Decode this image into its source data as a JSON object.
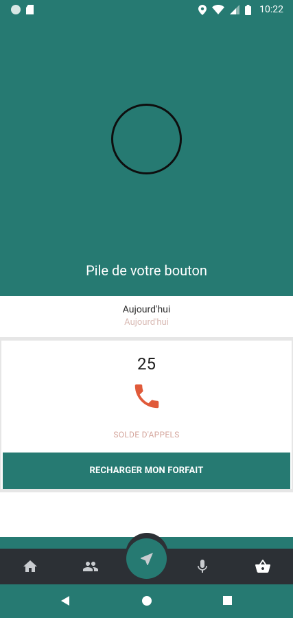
{
  "status_bar": {
    "time": "10:22",
    "icons": [
      "notification-dot-icon",
      "sd-card-icon",
      "location-icon",
      "wifi-icon",
      "signal-icon",
      "battery-icon"
    ]
  },
  "hero": {
    "title": "Pile de votre bouton",
    "background": "#267a72"
  },
  "today": {
    "label": "Aujourd'hui",
    "sub_label": "Aujourd'hui"
  },
  "calls_card": {
    "value": "25",
    "icon": "phone-icon",
    "icon_color": "#e05a3a",
    "caption": "SOLDE D'APPELS",
    "button_label": "RECHARGER MON FORFAIT"
  },
  "bottom_nav": {
    "items": [
      "home-icon",
      "people-icon",
      "navigation-icon",
      "microphone-icon",
      "basket-icon"
    ],
    "active": "navigation-icon"
  },
  "system_nav": {
    "items": [
      "back-icon",
      "home-circle-icon",
      "recents-icon"
    ]
  }
}
